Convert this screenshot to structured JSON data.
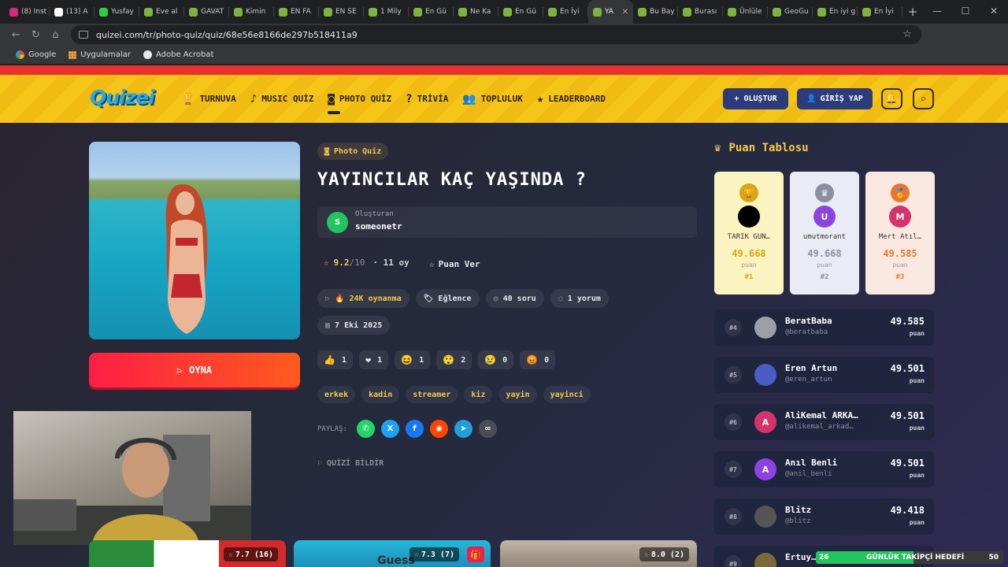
{
  "browser": {
    "tabs": [
      {
        "label": "(8) Inst",
        "color": "#d62976"
      },
      {
        "label": "(13) A",
        "color": "#ffffff"
      },
      {
        "label": "Yusfay",
        "color": "#2ecc40"
      },
      {
        "label": "Eve al",
        "color": "#7fb241"
      },
      {
        "label": "GAVAT",
        "color": "#7fb241"
      },
      {
        "label": "Kimin",
        "color": "#7fb241"
      },
      {
        "label": "EN FA",
        "color": "#7fb241"
      },
      {
        "label": "EN SE",
        "color": "#7fb241"
      },
      {
        "label": "1 Mily",
        "color": "#7fb241"
      },
      {
        "label": "En Gü",
        "color": "#7fb241"
      },
      {
        "label": "Ne Ka",
        "color": "#7fb241"
      },
      {
        "label": "En Gü",
        "color": "#7fb241"
      },
      {
        "label": "En İyi",
        "color": "#7fb241"
      },
      {
        "label": "YA",
        "color": "#7fb241",
        "active": true
      },
      {
        "label": "Bu Bay",
        "color": "#7fb241"
      },
      {
        "label": "Burası",
        "color": "#7fb241"
      },
      {
        "label": "Ünlüle",
        "color": "#7fb241"
      },
      {
        "label": "GeoGu",
        "color": "#7fb241"
      },
      {
        "label": "En iyi g",
        "color": "#7fb241"
      },
      {
        "label": "En İyi",
        "color": "#7fb241"
      }
    ],
    "url": "quizei.com/tr/photo-quiz/quiz/68e56e8166de297b518411a9",
    "bookmarks": [
      "Google",
      "Uygulamalar",
      "Adobe Acrobat"
    ]
  },
  "site": {
    "logo": "Quizei",
    "nav": [
      {
        "label": "TURNUVA",
        "icon": "trophy-icon",
        "glyph": "🏆"
      },
      {
        "label": "MUSIC QUİZ",
        "icon": "music-icon",
        "glyph": "♪"
      },
      {
        "label": "PHOTO QUİZ",
        "icon": "camera-icon",
        "glyph": "◙",
        "active": true
      },
      {
        "label": "TRİVİA",
        "icon": "chat-icon",
        "glyph": "?"
      },
      {
        "label": "TOPLULUK",
        "icon": "users-icon",
        "glyph": "👥"
      },
      {
        "label": "LEADERBOARD",
        "icon": "medal-icon",
        "glyph": "★"
      }
    ],
    "create_label": "+ OLUŞTUR",
    "login_label": "GİRİŞ YAP"
  },
  "quiz": {
    "badge": "Photo Quiz",
    "title": "YAYINCILAR KAÇ YAŞINDA ?",
    "creator_label": "Oluşturan",
    "creator_name": "someonetr",
    "creator_initial": "S",
    "rating_score": "9.2",
    "rating_max": "/10",
    "rating_votes": "· 11 oy",
    "rate_label": "Puan Ver",
    "plays": "24K oynanma",
    "category": "Eğlence",
    "questions": "40 soru",
    "comments": "1 yorum",
    "date": "7 Eki 2025",
    "play_label": "OYNA",
    "reactions": [
      {
        "emoji": "👍",
        "count": "1",
        "icon": "thumbs-up-icon"
      },
      {
        "emoji": "❤",
        "count": "1",
        "icon": "heart-icon"
      },
      {
        "emoji": "😆",
        "count": "1",
        "icon": "laugh-icon"
      },
      {
        "emoji": "😲",
        "count": "2",
        "icon": "wow-icon"
      },
      {
        "emoji": "😢",
        "count": "0",
        "icon": "sad-icon"
      },
      {
        "emoji": "😡",
        "count": "0",
        "icon": "angry-icon"
      }
    ],
    "tags": [
      "erkek",
      "kadin",
      "streamer",
      "kiz",
      "yayin",
      "yayinci"
    ],
    "share_label": "PAYLAŞ:",
    "report_label": "QUİZİ BİLDİR"
  },
  "cards": [
    {
      "rating": "7.7 (16)"
    },
    {
      "rating": "7.3 (7)",
      "text": "Guess"
    },
    {
      "rating": "8.0 (2)"
    }
  ],
  "leaderboard": {
    "title": "Puan Tablosu",
    "podium": [
      {
        "rank": "#1",
        "name": "TARIK GÜN…",
        "score": "49.668",
        "unit": "puan",
        "initial": "",
        "avatar_color": "#000000",
        "accent": "#d9a514"
      },
      {
        "rank": "#2",
        "name": "umutmorant",
        "score": "49.668",
        "unit": "puan",
        "initial": "U",
        "avatar_color": "#8b44e0",
        "accent": "#8c8fa0"
      },
      {
        "rank": "#3",
        "name": "Mert Atıl…",
        "score": "49.585",
        "unit": "puan",
        "initial": "M",
        "avatar_color": "#d6336c",
        "accent": "#e8782e"
      }
    ],
    "rows": [
      {
        "rank": "#4",
        "name": "BeratBaba",
        "handle": "@beratbaba",
        "score": "49.585",
        "unit": "puan",
        "initial": "",
        "avatar_color": "#9aa0a6"
      },
      {
        "rank": "#5",
        "name": "Eren Artun",
        "handle": "@eren_artun",
        "score": "49.501",
        "unit": "puan",
        "initial": "",
        "avatar_color": "#4b5cc4"
      },
      {
        "rank": "#6",
        "name": "AliKemal ARKA…",
        "handle": "@alikemal_arkad…",
        "score": "49.501",
        "unit": "puan",
        "initial": "A",
        "avatar_color": "#d6336c"
      },
      {
        "rank": "#7",
        "name": "Anıl Benli",
        "handle": "@anil_benli",
        "score": "49.501",
        "unit": "puan",
        "initial": "A",
        "avatar_color": "#8b44e0"
      },
      {
        "rank": "#8",
        "name": "Blitz",
        "handle": "@blitz",
        "score": "49.418",
        "unit": "puan",
        "initial": "",
        "avatar_color": "#555555"
      },
      {
        "rank": "#9",
        "name": "Ertuy…",
        "handle": "",
        "score": "",
        "unit": "",
        "initial": "",
        "avatar_color": "#7a6a3a"
      }
    ]
  },
  "overlay": {
    "goal_left": "26",
    "goal_text": "GÜNLÜK TAKİPÇİ HEDEFİ",
    "goal_right": "50",
    "goal_progress": 0.52
  }
}
